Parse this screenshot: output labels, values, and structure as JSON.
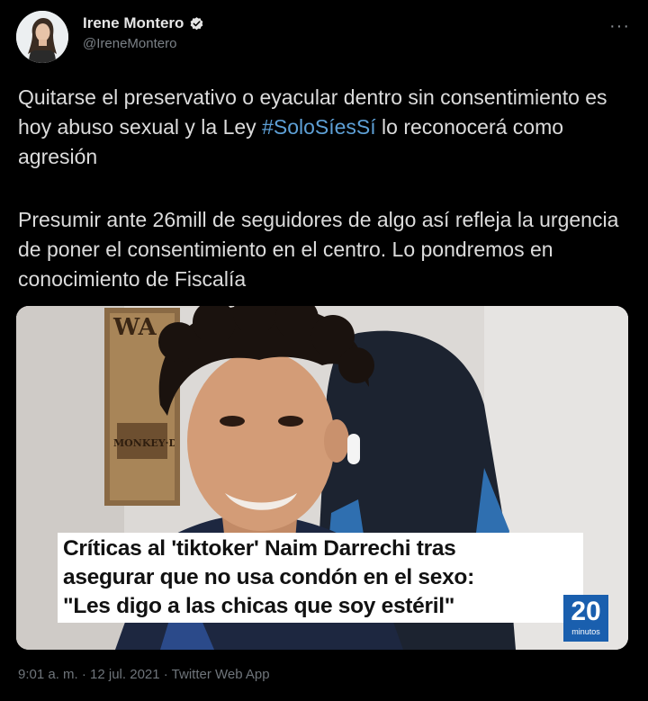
{
  "author": {
    "display_name": "Irene Montero",
    "handle": "@IreneMontero",
    "verified_icon": "verified-badge-icon"
  },
  "more_label": "···",
  "tweet": {
    "paragraph1_pre": "Quitarse el preservativo o eyacular dentro sin consentimiento es hoy abuso sexual y la Ley ",
    "hashtag": "#SoloSíesSí",
    "paragraph1_post": " lo reconocerá como agresión",
    "paragraph2": "Presumir ante 26mill de seguidores de algo así refleja la urgencia de poner el consentimiento en el centro. Lo pondremos en conocimiento de Fiscalía"
  },
  "media": {
    "caption_line1": "Críticas al 'tiktoker' Naim Darrechi tras",
    "caption_line2": "asegurar que no usa condón en el sexo:",
    "caption_line3": "\"Les digo a las chicas que soy estéril\"",
    "brand_number": "20",
    "brand_word": "minutos",
    "poster_text_top": "WA",
    "poster_text_mid": "MONKEY·D·"
  },
  "meta": {
    "timestamp": "9:01 a. m. · 12 jul. 2021 · Twitter Web App"
  },
  "colors": {
    "background": "#000000",
    "hashtag": "#5ea0d6",
    "verified": "#1d9bf0",
    "brand": "#1a5fae"
  }
}
